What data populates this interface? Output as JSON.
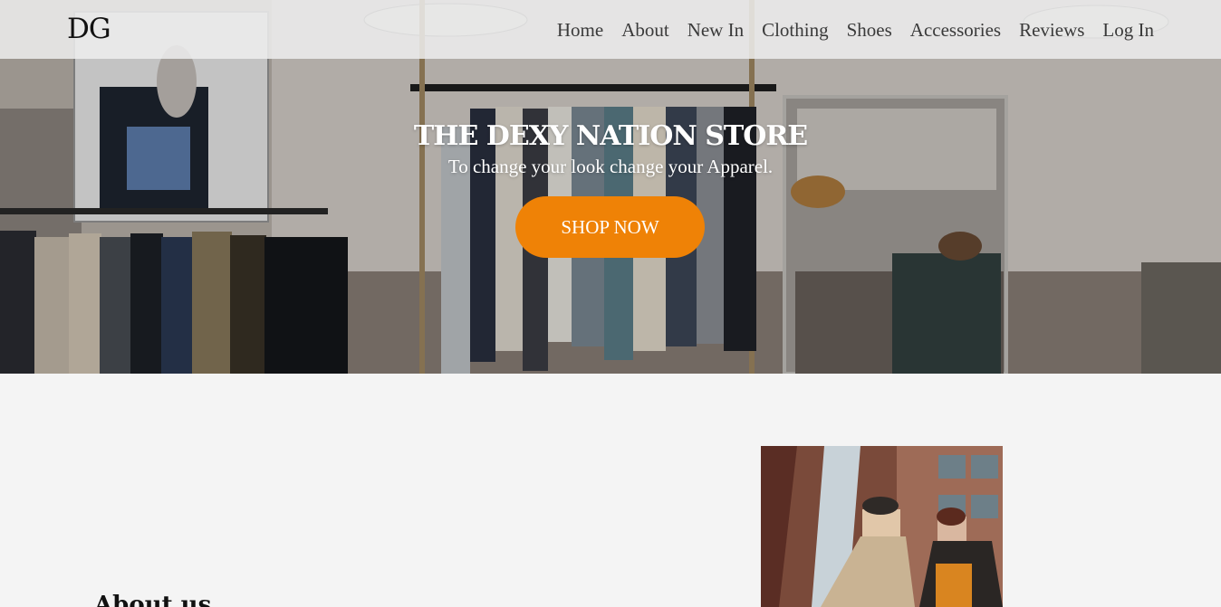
{
  "brand": {
    "logo": "DG"
  },
  "nav": {
    "items": [
      {
        "label": "Home"
      },
      {
        "label": "About"
      },
      {
        "label": "New In"
      },
      {
        "label": "Clothing"
      },
      {
        "label": "Shoes"
      },
      {
        "label": "Accessories"
      },
      {
        "label": "Reviews"
      },
      {
        "label": "Log In"
      }
    ]
  },
  "hero": {
    "title": "THE DEXY NATION STORE",
    "subtitle": "To change your look change your Apparel.",
    "cta_label": "SHOP NOW",
    "cta_color": "#ef8206"
  },
  "about": {
    "heading": "About us"
  }
}
